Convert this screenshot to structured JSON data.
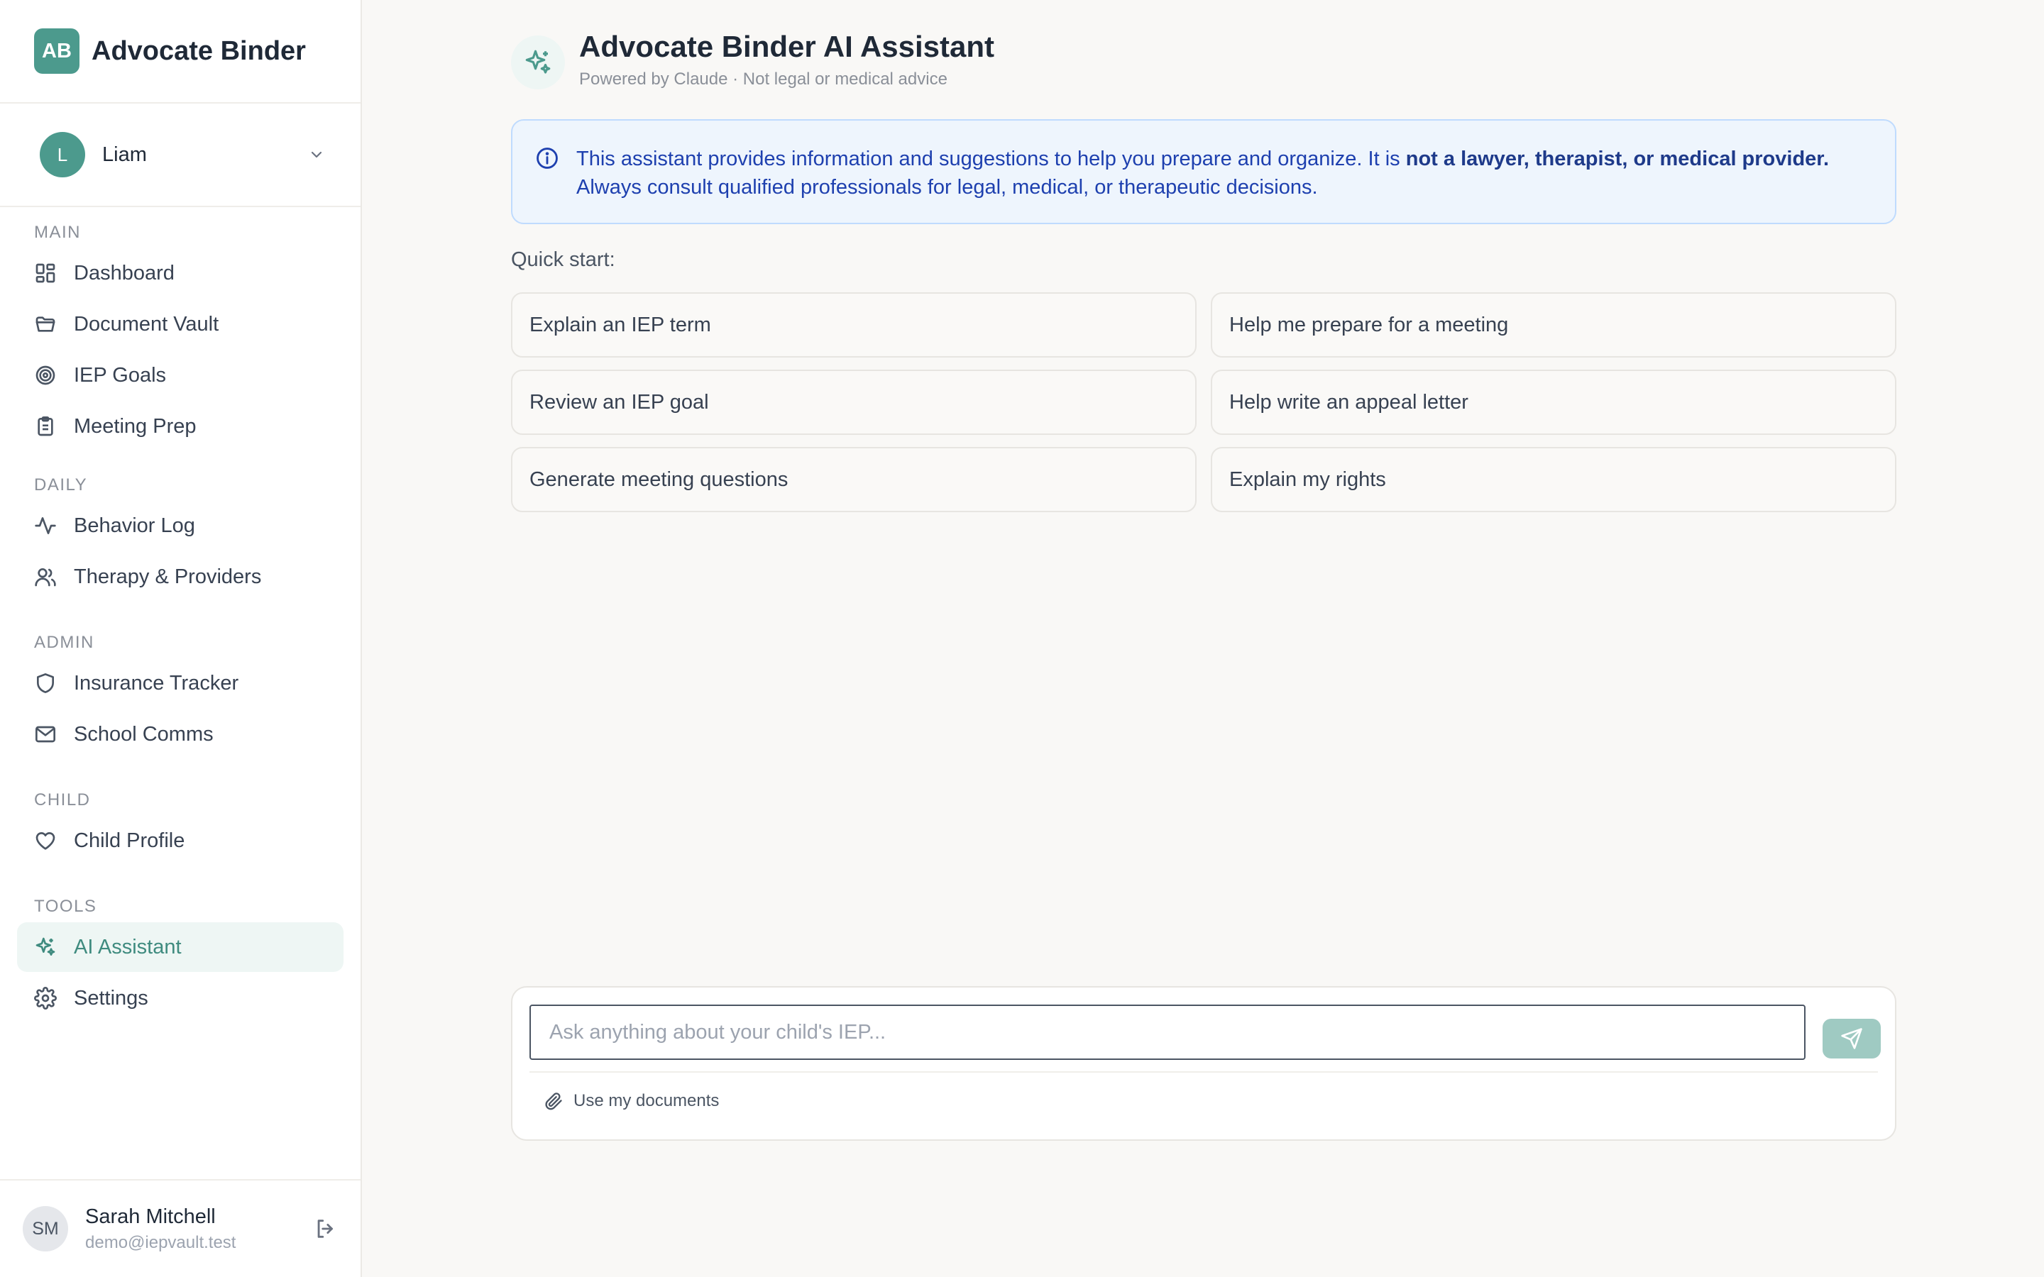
{
  "brand": {
    "badge": "AB",
    "name": "Advocate Binder"
  },
  "child_selector": {
    "initial": "L",
    "name": "Liam"
  },
  "nav": {
    "sections": [
      {
        "title": "MAIN",
        "items": [
          {
            "label": "Dashboard",
            "icon": "grid-icon"
          },
          {
            "label": "Document Vault",
            "icon": "folder-icon"
          },
          {
            "label": "IEP Goals",
            "icon": "target-icon"
          },
          {
            "label": "Meeting Prep",
            "icon": "clipboard-icon"
          }
        ]
      },
      {
        "title": "DAILY",
        "items": [
          {
            "label": "Behavior Log",
            "icon": "activity-icon"
          },
          {
            "label": "Therapy & Providers",
            "icon": "users-icon"
          }
        ]
      },
      {
        "title": "ADMIN",
        "items": [
          {
            "label": "Insurance Tracker",
            "icon": "shield-icon"
          },
          {
            "label": "School Comms",
            "icon": "mail-icon"
          }
        ]
      },
      {
        "title": "CHILD",
        "items": [
          {
            "label": "Child Profile",
            "icon": "heart-icon"
          }
        ]
      },
      {
        "title": "TOOLS",
        "items": [
          {
            "label": "AI Assistant",
            "icon": "sparkles-icon",
            "active": true
          },
          {
            "label": "Settings",
            "icon": "gear-icon"
          }
        ]
      }
    ]
  },
  "user": {
    "initials": "SM",
    "name": "Sarah Mitchell",
    "email": "demo@iepvault.test"
  },
  "header": {
    "title": "Advocate Binder AI Assistant",
    "subtitle": "Powered by Claude · Not legal or medical advice"
  },
  "notice": {
    "text_before": "This assistant provides information and suggestions to help you prepare and organize. It is ",
    "bold": "not a lawyer, therapist, or medical provider.",
    "text_after": " Always consult qualified professionals for legal, medical, or therapeutic decisions."
  },
  "quick_start": {
    "label": "Quick start:",
    "items": [
      "Explain an IEP term",
      "Help me prepare for a meeting",
      "Review an IEP goal",
      "Help write an appeal letter",
      "Generate meeting questions",
      "Explain my rights"
    ]
  },
  "composer": {
    "placeholder": "Ask anything about your child's IEP...",
    "value": "",
    "attach_label": "Use my documents"
  },
  "colors": {
    "accent": "#4c9a8d",
    "active_bg": "#eef6f4",
    "notice_bg": "#eef5fd",
    "notice_text": "#1e40af",
    "send_disabled": "#9fcac2"
  }
}
